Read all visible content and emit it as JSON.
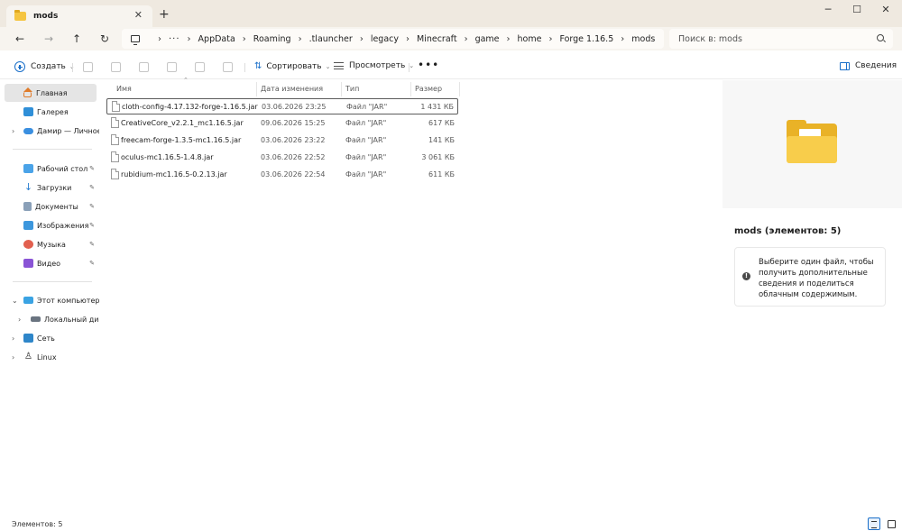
{
  "tab": {
    "title": "mods"
  },
  "address": {
    "ellipsis": "···",
    "crumbs": [
      "AppData",
      "Roaming",
      ".tlauncher",
      "legacy",
      "Minecraft",
      "game",
      "home",
      "Forge 1.16.5",
      "mods"
    ]
  },
  "search": {
    "placeholder": "Поиск в: mods"
  },
  "toolbar": {
    "create_label": "Создать",
    "sort_label": "Сортировать",
    "view_label": "Просмотреть",
    "details_label": "Сведения"
  },
  "sidebar": {
    "items": [
      {
        "label": "Главная"
      },
      {
        "label": "Галерея"
      },
      {
        "label": "Дамир — Личное"
      },
      {
        "label": "Рабочий стол"
      },
      {
        "label": "Загрузки"
      },
      {
        "label": "Документы"
      },
      {
        "label": "Изображения"
      },
      {
        "label": "Музыка"
      },
      {
        "label": "Видео"
      },
      {
        "label": "Этот компьютер"
      },
      {
        "label": "Локальный диск"
      },
      {
        "label": "Сеть"
      },
      {
        "label": "Linux"
      }
    ]
  },
  "columns": {
    "name": "Имя",
    "date": "Дата изменения",
    "type": "Тип",
    "size": "Размер"
  },
  "files": [
    {
      "name": "cloth-config-4.17.132-forge-1.16.5.jar",
      "date": "03.06.2026 23:25",
      "type": "Файл \"JAR\"",
      "size": "1 431 КБ"
    },
    {
      "name": "CreativeCore_v2.2.1_mc1.16.5.jar",
      "date": "09.06.2026 15:25",
      "type": "Файл \"JAR\"",
      "size": "617 КБ"
    },
    {
      "name": "freecam-forge-1.3.5-mc1.16.5.jar",
      "date": "03.06.2026 23:22",
      "type": "Файл \"JAR\"",
      "size": "141 КБ"
    },
    {
      "name": "oculus-mc1.16.5-1.4.8.jar",
      "date": "03.06.2026 22:52",
      "type": "Файл \"JAR\"",
      "size": "3 061 КБ"
    },
    {
      "name": "rubidium-mc1.16.5-0.2.13.jar",
      "date": "03.06.2026 22:54",
      "type": "Файл \"JAR\"",
      "size": "611 КБ"
    }
  ],
  "details": {
    "title": "mods (элементов: 5)",
    "info": "Выберите один файл, чтобы получить дополнительные сведения и поделиться облачным содержимым."
  },
  "status": {
    "text": "Элементов: 5"
  },
  "colors": {
    "accent": "#1a6fc9",
    "folder": "#f8cd4b",
    "titlebar": "#efe9e0"
  }
}
